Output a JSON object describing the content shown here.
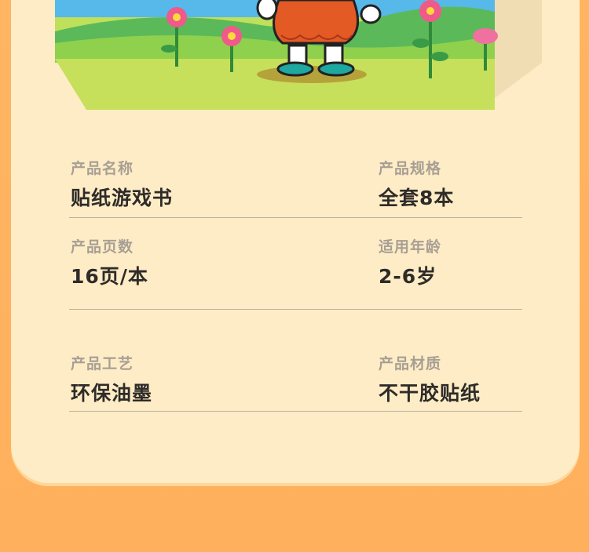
{
  "specs": [
    {
      "left": {
        "label": "产品名称",
        "value": "贴纸游戏书"
      },
      "right": {
        "label": "产品规格",
        "value": "全套8本"
      }
    },
    {
      "left": {
        "label": "产品页数",
        "value": "16页/本"
      },
      "right": {
        "label": "适用年龄",
        "value": "2-6岁"
      }
    },
    {
      "left": {
        "label": "产品工艺",
        "value": "环保油墨"
      },
      "right": {
        "label": "产品材质",
        "value": "不干胶贴纸"
      }
    }
  ],
  "colors": {
    "background": "#ffb562",
    "card": "#fdecc5",
    "label": "#a89f94",
    "value": "#2e2b29",
    "divider": "#bdb1a2"
  }
}
